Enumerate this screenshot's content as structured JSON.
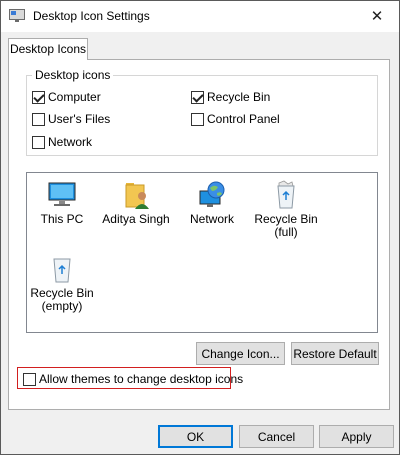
{
  "window": {
    "title": "Desktop Icon Settings",
    "close_glyph": "✕"
  },
  "tabs": [
    {
      "label": "Desktop Icons",
      "active": true
    }
  ],
  "desktop_icons_group": {
    "title": "Desktop icons",
    "checkboxes": [
      {
        "label": "Computer",
        "checked": true
      },
      {
        "label": "Recycle Bin",
        "checked": true
      },
      {
        "label": "User's Files",
        "checked": false
      },
      {
        "label": "Control Panel",
        "checked": false
      },
      {
        "label": "Network",
        "checked": false
      }
    ]
  },
  "icon_list": [
    {
      "label": "This PC",
      "icon": "monitor-icon"
    },
    {
      "label": "Aditya Singh",
      "icon": "user-folder-icon"
    },
    {
      "label": "Network",
      "icon": "network-globe-icon"
    },
    {
      "label": "Recycle Bin\n(full)",
      "icon": "recycle-bin-full-icon"
    },
    {
      "label": "Recycle Bin\n(empty)",
      "icon": "recycle-bin-empty-icon"
    }
  ],
  "buttons": {
    "change_icon": "Change Icon...",
    "restore_default": "Restore Default",
    "ok": "OK",
    "cancel": "Cancel",
    "apply": "Apply"
  },
  "allow_themes": {
    "label": "Allow themes to change desktop icons",
    "checked": false
  },
  "colors": {
    "accent": "#0078d7",
    "highlight_outline": "#d21f1f",
    "window_bg": "#f0f0f0"
  }
}
